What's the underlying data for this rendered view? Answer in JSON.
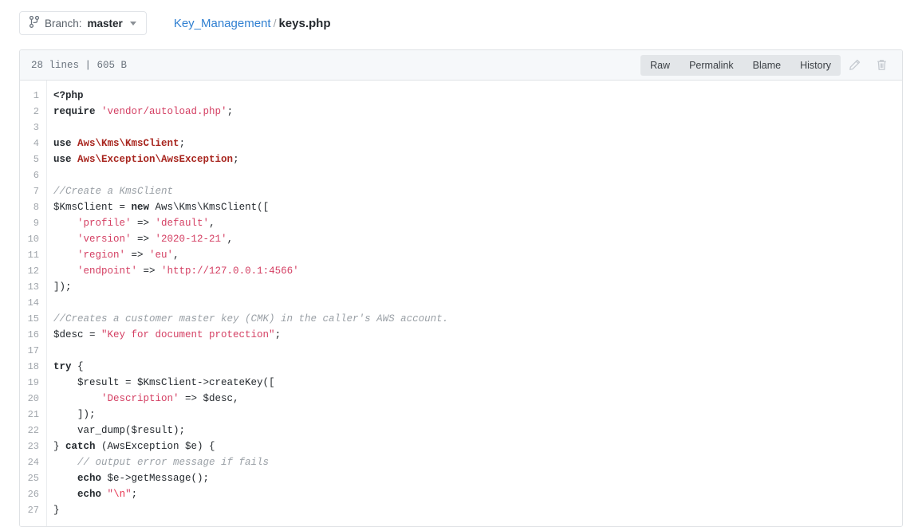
{
  "topbar": {
    "branch_button": {
      "icon": "git-branch-icon",
      "prefix_label": "Branch:",
      "branch_name": "master",
      "caret": "chevron-down-icon"
    },
    "breadcrumb": {
      "repo_folder": "Key_Management",
      "separator": "/",
      "file_name": "keys.php"
    }
  },
  "file_panel": {
    "meta": "28 lines | 605 B",
    "actions": {
      "raw": "Raw",
      "permalink": "Permalink",
      "blame": "Blame",
      "history": "History",
      "edit_icon": "pencil-icon",
      "delete_icon": "trash-icon"
    }
  },
  "colors": {
    "link": "#2f7fd1",
    "string": "#d43f63",
    "escape": "#e8314c",
    "namespace": "#a8261f",
    "comment": "#9aa0a6",
    "keyword": "#24292e",
    "panel_border": "#dfe2e5",
    "header_bg": "#f6f8fa",
    "btn_group_bg": "#e3e6e9"
  },
  "code": {
    "language": "php",
    "line_numbers": [
      1,
      2,
      3,
      4,
      5,
      6,
      7,
      8,
      9,
      10,
      11,
      12,
      13,
      14,
      15,
      16,
      17,
      18,
      19,
      20,
      21,
      22,
      23,
      24,
      25,
      26,
      27
    ],
    "lines": [
      {
        "n": 1,
        "text": "<?php",
        "tokens": [
          {
            "t": "<?php",
            "c": "t-kw"
          }
        ]
      },
      {
        "n": 2,
        "text": "require 'vendor/autoload.php';",
        "tokens": [
          {
            "t": "require",
            "c": "t-kw"
          },
          {
            "t": " ",
            "c": "t-pln"
          },
          {
            "t": "'vendor/autoload.php'",
            "c": "t-str"
          },
          {
            "t": ";",
            "c": "t-pln"
          }
        ]
      },
      {
        "n": 3,
        "text": "",
        "tokens": []
      },
      {
        "n": 4,
        "text": "use Aws\\Kms\\KmsClient;",
        "tokens": [
          {
            "t": "use",
            "c": "t-kw"
          },
          {
            "t": " ",
            "c": "t-pln"
          },
          {
            "t": "Aws\\Kms\\KmsClient",
            "c": "t-ns"
          },
          {
            "t": ";",
            "c": "t-pln"
          }
        ]
      },
      {
        "n": 5,
        "text": "use Aws\\Exception\\AwsException;",
        "tokens": [
          {
            "t": "use",
            "c": "t-kw"
          },
          {
            "t": " ",
            "c": "t-pln"
          },
          {
            "t": "Aws\\Exception\\AwsException",
            "c": "t-ns"
          },
          {
            "t": ";",
            "c": "t-pln"
          }
        ]
      },
      {
        "n": 6,
        "text": "",
        "tokens": []
      },
      {
        "n": 7,
        "text": "//Create a KmsClient",
        "tokens": [
          {
            "t": "//Create a KmsClient",
            "c": "t-com"
          }
        ]
      },
      {
        "n": 8,
        "text": "$KmsClient = new Aws\\Kms\\KmsClient([",
        "tokens": [
          {
            "t": "$KmsClient = ",
            "c": "t-pln"
          },
          {
            "t": "new",
            "c": "t-kw"
          },
          {
            "t": " Aws\\Kms\\KmsClient([",
            "c": "t-pln"
          }
        ]
      },
      {
        "n": 9,
        "text": "    'profile' => 'default',",
        "tokens": [
          {
            "t": "    ",
            "c": "t-pln"
          },
          {
            "t": "'profile'",
            "c": "t-str"
          },
          {
            "t": " => ",
            "c": "t-pln"
          },
          {
            "t": "'default'",
            "c": "t-str"
          },
          {
            "t": ",",
            "c": "t-pln"
          }
        ]
      },
      {
        "n": 10,
        "text": "    'version' => '2020-12-21',",
        "tokens": [
          {
            "t": "    ",
            "c": "t-pln"
          },
          {
            "t": "'version'",
            "c": "t-str"
          },
          {
            "t": " => ",
            "c": "t-pln"
          },
          {
            "t": "'2020-12-21'",
            "c": "t-str"
          },
          {
            "t": ",",
            "c": "t-pln"
          }
        ]
      },
      {
        "n": 11,
        "text": "    'region' => 'eu',",
        "tokens": [
          {
            "t": "    ",
            "c": "t-pln"
          },
          {
            "t": "'region'",
            "c": "t-str"
          },
          {
            "t": " => ",
            "c": "t-pln"
          },
          {
            "t": "'eu'",
            "c": "t-str"
          },
          {
            "t": ",",
            "c": "t-pln"
          }
        ]
      },
      {
        "n": 12,
        "text": "    'endpoint' => 'http://127.0.0.1:4566'",
        "tokens": [
          {
            "t": "    ",
            "c": "t-pln"
          },
          {
            "t": "'endpoint'",
            "c": "t-str"
          },
          {
            "t": " => ",
            "c": "t-pln"
          },
          {
            "t": "'http://127.0.0.1:4566'",
            "c": "t-str"
          }
        ]
      },
      {
        "n": 13,
        "text": "]);",
        "tokens": [
          {
            "t": "]);",
            "c": "t-pln"
          }
        ]
      },
      {
        "n": 14,
        "text": "",
        "tokens": []
      },
      {
        "n": 15,
        "text": "//Creates a customer master key (CMK) in the caller's AWS account.",
        "tokens": [
          {
            "t": "//Creates a customer master key (CMK) in the caller's AWS account.",
            "c": "t-com"
          }
        ]
      },
      {
        "n": 16,
        "text": "$desc = \"Key for document protection\";",
        "tokens": [
          {
            "t": "$desc = ",
            "c": "t-pln"
          },
          {
            "t": "\"Key for document protection\"",
            "c": "t-str"
          },
          {
            "t": ";",
            "c": "t-pln"
          }
        ]
      },
      {
        "n": 17,
        "text": "",
        "tokens": []
      },
      {
        "n": 18,
        "text": "try {",
        "tokens": [
          {
            "t": "try",
            "c": "t-kw"
          },
          {
            "t": " {",
            "c": "t-pln"
          }
        ]
      },
      {
        "n": 19,
        "text": "    $result = $KmsClient->createKey([",
        "tokens": [
          {
            "t": "    $result = $KmsClient->createKey([",
            "c": "t-pln"
          }
        ]
      },
      {
        "n": 20,
        "text": "        'Description' => $desc,",
        "tokens": [
          {
            "t": "        ",
            "c": "t-pln"
          },
          {
            "t": "'Description'",
            "c": "t-str"
          },
          {
            "t": " => $desc,",
            "c": "t-pln"
          }
        ]
      },
      {
        "n": 21,
        "text": "    ]);",
        "tokens": [
          {
            "t": "    ]);",
            "c": "t-pln"
          }
        ]
      },
      {
        "n": 22,
        "text": "    var_dump($result);",
        "tokens": [
          {
            "t": "    var_dump($result);",
            "c": "t-pln"
          }
        ]
      },
      {
        "n": 23,
        "text": "} catch (AwsException $e) {",
        "tokens": [
          {
            "t": "} ",
            "c": "t-pln"
          },
          {
            "t": "catch",
            "c": "t-kw"
          },
          {
            "t": " (AwsException $e) {",
            "c": "t-pln"
          }
        ]
      },
      {
        "n": 24,
        "text": "    // output error message if fails",
        "tokens": [
          {
            "t": "    ",
            "c": "t-pln"
          },
          {
            "t": "// output error message if fails",
            "c": "t-com"
          }
        ]
      },
      {
        "n": 25,
        "text": "    echo $e->getMessage();",
        "tokens": [
          {
            "t": "    ",
            "c": "t-pln"
          },
          {
            "t": "echo",
            "c": "t-kw"
          },
          {
            "t": " $e->getMessage();",
            "c": "t-pln"
          }
        ]
      },
      {
        "n": 26,
        "text": "    echo \"\\n\";",
        "tokens": [
          {
            "t": "    ",
            "c": "t-pln"
          },
          {
            "t": "echo",
            "c": "t-kw"
          },
          {
            "t": " ",
            "c": "t-pln"
          },
          {
            "t": "\"",
            "c": "t-str"
          },
          {
            "t": "\\n",
            "c": "t-esc"
          },
          {
            "t": "\"",
            "c": "t-str"
          },
          {
            "t": ";",
            "c": "t-pln"
          }
        ]
      },
      {
        "n": 27,
        "text": "}",
        "tokens": [
          {
            "t": "}",
            "c": "t-pln"
          }
        ]
      }
    ]
  }
}
